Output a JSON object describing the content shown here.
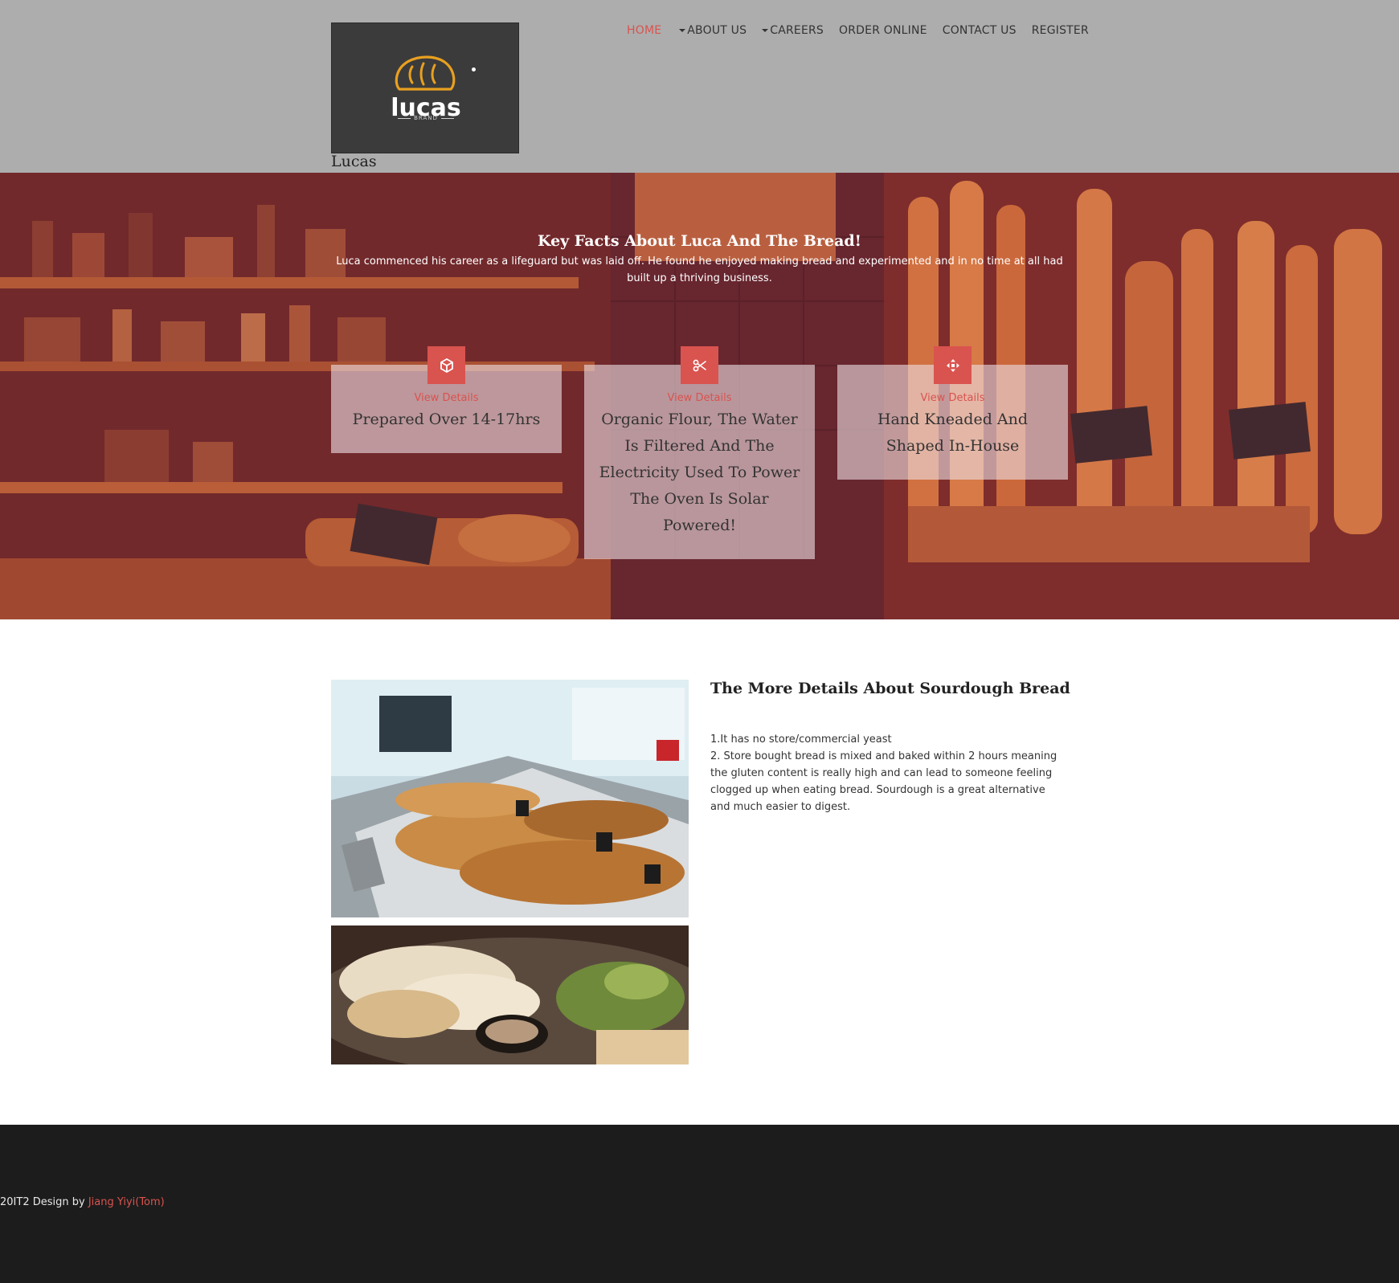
{
  "brand": {
    "logo_word": "lucas",
    "logo_sub": "BRAND",
    "site_name": "Lucas"
  },
  "nav": {
    "items": [
      {
        "label": "HOME",
        "active": true,
        "dropdown": false
      },
      {
        "label": "ABOUT US",
        "active": false,
        "dropdown": true
      },
      {
        "label": "CAREERS",
        "active": false,
        "dropdown": true
      },
      {
        "label": "ORDER ONLINE",
        "active": false,
        "dropdown": false
      },
      {
        "label": "CONTACT US",
        "active": false,
        "dropdown": false
      },
      {
        "label": "REGISTER",
        "active": false,
        "dropdown": false
      }
    ]
  },
  "hero": {
    "title": "Key Facts About Luca And The Bread!",
    "text": "Luca commenced his career as a lifeguard but was laid off. He found he enjoyed making bread and experimented and in no time at all had built up a thriving business."
  },
  "cards": [
    {
      "icon": "cube-icon",
      "link": "View Details",
      "title": "Prepared Over 14-17hrs"
    },
    {
      "icon": "scissors-icon",
      "link": "View Details",
      "title": "Organic Flour, The Water Is Filtered And The Electricity Used To Power The Oven Is Solar Powered!"
    },
    {
      "icon": "move-arrows-icon",
      "link": "View Details",
      "title": "Hand Kneaded And Shaped In-House"
    }
  ],
  "about": {
    "title": "The More Details About Sourdough Bread",
    "point1": "1.It has no store/commercial yeast",
    "point2": "2. Store bought bread is mixed and baked within 2 hours meaning the gluten content is really high and can lead to someone feeling clogged up when eating bread. Sourdough is a great alternative and much easier to digest."
  },
  "footer": {
    "prefix": "20IT2 Design by ",
    "author": "Jiang Yiyi(Tom)"
  },
  "colors": {
    "accent": "#d9534f",
    "header_bg": "#adadad",
    "footer_bg": "#1c1c1c",
    "logo_bg": "#3b3b3b",
    "logo_orange": "#e8a020"
  }
}
